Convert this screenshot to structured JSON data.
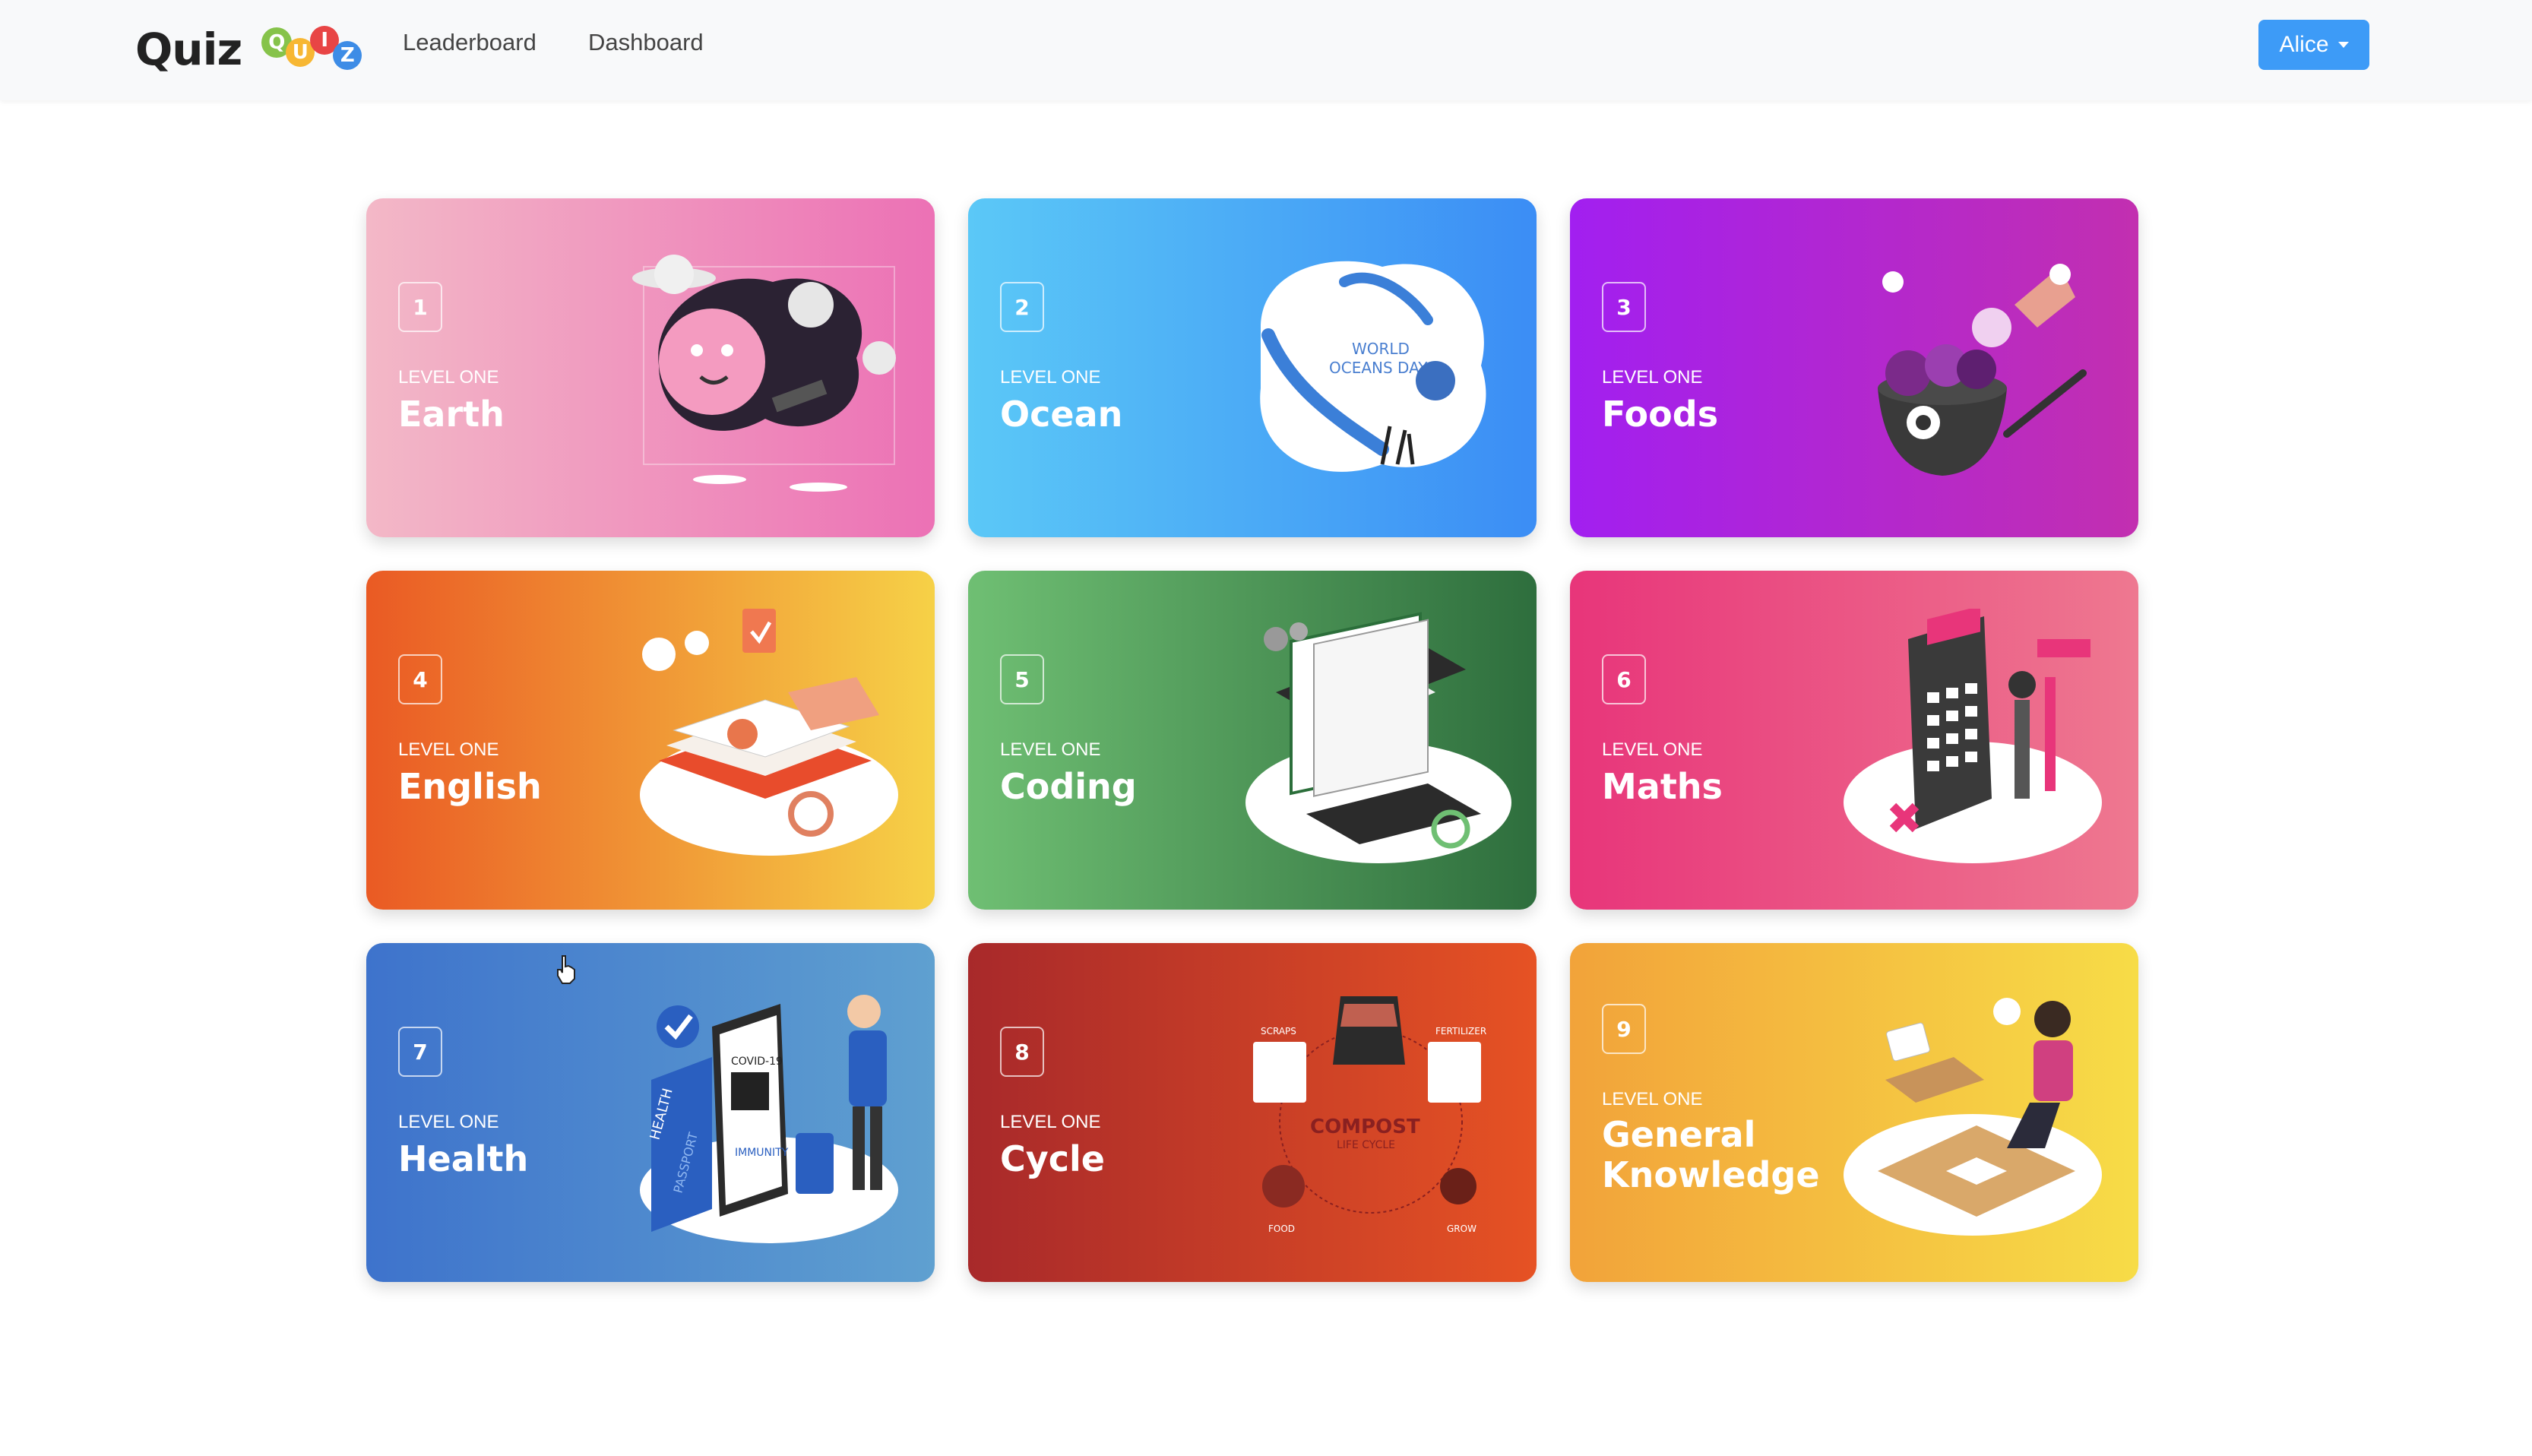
{
  "navbar": {
    "brand": "Quiz",
    "logo_letters": [
      "Q",
      "U",
      "I",
      "Z"
    ],
    "links": [
      "Leaderboard",
      "Dashboard"
    ],
    "user": "Alice"
  },
  "cards": [
    {
      "number": "1",
      "level": "LEVEL ONE",
      "title": "Earth",
      "gradient": [
        "#f3b8c7",
        "#ec71b5"
      ],
      "icon": "planet-illustration"
    },
    {
      "number": "2",
      "level": "LEVEL ONE",
      "title": "Ocean",
      "gradient": [
        "#5bc8f7",
        "#3b8df5"
      ],
      "icon": "ocean-illustration",
      "illustration_text": [
        "WORLD",
        "OCEANS DAY"
      ]
    },
    {
      "number": "3",
      "level": "LEVEL ONE",
      "title": "Foods",
      "gradient": [
        "#a21ff0",
        "#c22fb0"
      ],
      "icon": "food-bowl-illustration"
    },
    {
      "number": "4",
      "level": "LEVEL ONE",
      "title": "English",
      "gradient": [
        "#ea5a24",
        "#f6d147"
      ],
      "icon": "books-illustration"
    },
    {
      "number": "5",
      "level": "LEVEL ONE",
      "title": "Coding",
      "gradient": [
        "#6fbf73",
        "#2e6e3d"
      ],
      "icon": "laptop-code-illustration"
    },
    {
      "number": "6",
      "level": "LEVEL ONE",
      "title": "Maths",
      "gradient": [
        "#e8357a",
        "#ee7890"
      ],
      "icon": "calculator-illustration"
    },
    {
      "number": "7",
      "level": "LEVEL ONE",
      "title": "Health",
      "gradient": [
        "#3e73cc",
        "#5fa0d0"
      ],
      "icon": "health-passport-illustration",
      "illustration_text": [
        "HEALTH",
        "PASSPORT",
        "COVID-19",
        "IMMUNITY"
      ]
    },
    {
      "number": "8",
      "level": "LEVEL ONE",
      "title": "Cycle",
      "gradient": [
        "#a8292a",
        "#e65224"
      ],
      "icon": "compost-illustration",
      "illustration_text": [
        "COMPOST",
        "LIFE CYCLE",
        "SCRAPS",
        "FERTILIZER",
        "FOOD",
        "GROW"
      ]
    },
    {
      "number": "9",
      "level": "LEVEL ONE",
      "title": "General Knowledge",
      "gradient": [
        "#f2a33a",
        "#f7dc47"
      ],
      "icon": "puzzle-illustration"
    }
  ]
}
